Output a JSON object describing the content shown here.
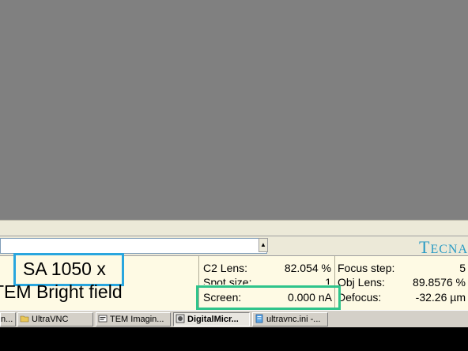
{
  "brand": {
    "big": "T",
    "small": "ECNA"
  },
  "magnification": {
    "text": "SA 1050 x"
  },
  "mode": {
    "text": "TEM Bright field"
  },
  "readouts": {
    "c2_lens_label": "C2 Lens:",
    "c2_lens_value": "82.054 %",
    "spot_size_label": "Spot size:",
    "spot_size_value": "1",
    "screen_label": "Screen:",
    "screen_value": "0.000 nA",
    "focus_step_label": "Focus step:",
    "focus_step_value": "5",
    "obj_lens_label": "Obj Lens:",
    "obj_lens_value": "89.8576 %",
    "defocus_label": "Defocus:",
    "defocus_value": "-32.26 µm"
  },
  "combo": {
    "arrow": "▲"
  },
  "taskbar": {
    "items": [
      {
        "label": "n...",
        "icon": "window-icon"
      },
      {
        "label": "UltraVNC",
        "icon": "folder-icon"
      },
      {
        "label": "TEM Imagin...",
        "icon": "app-icon"
      },
      {
        "label": "DigitalMicr...",
        "icon": "microscope-icon"
      },
      {
        "label": "ultravnc.ini -...",
        "icon": "notepad-icon"
      }
    ]
  },
  "colors": {
    "brand": "#2a9bc4",
    "magnification_box": "#29a6de",
    "screen_box": "#2fc48b",
    "panel_background": "#fefae4"
  }
}
